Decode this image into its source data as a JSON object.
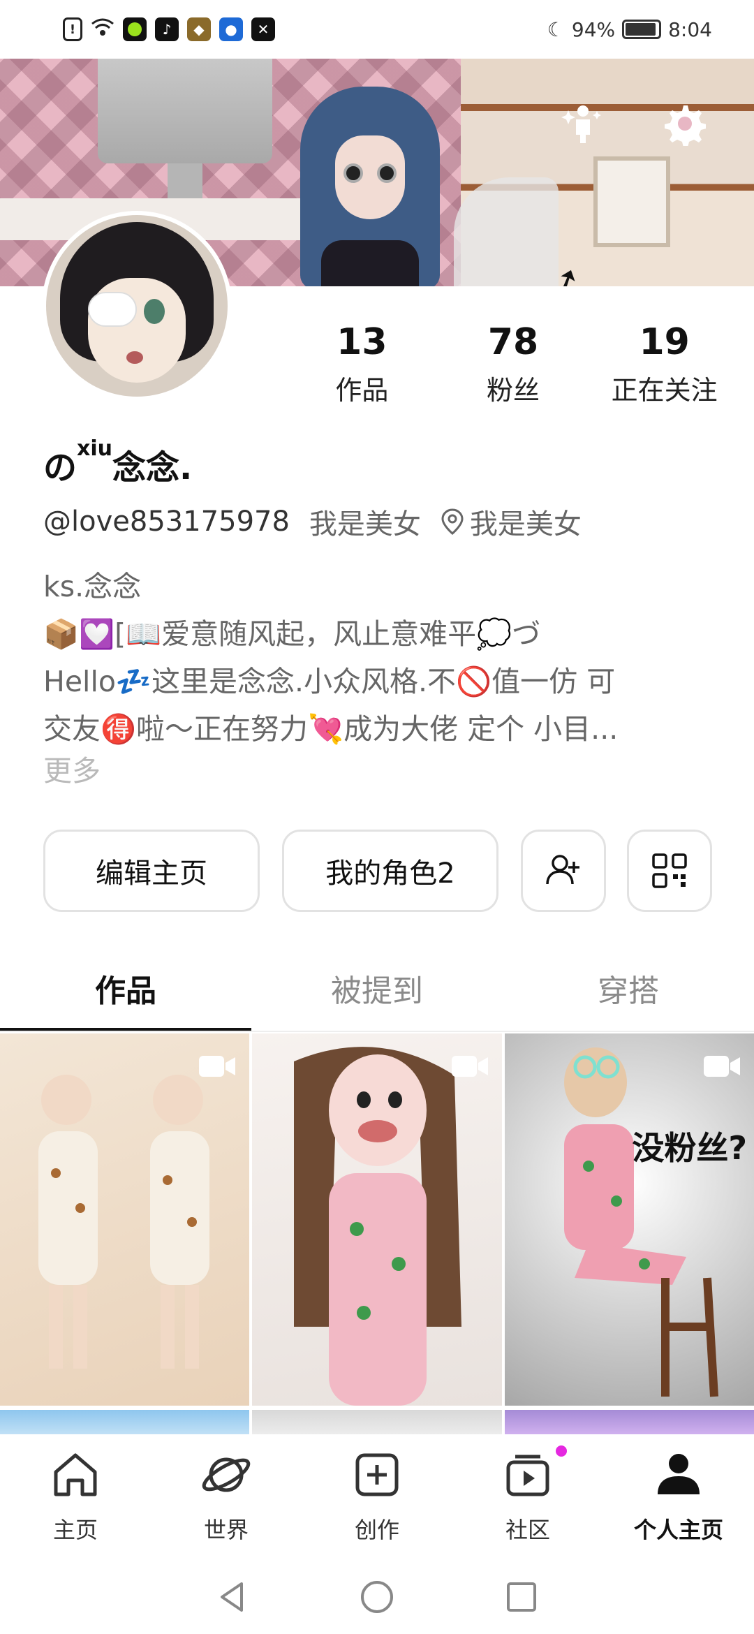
{
  "status_bar": {
    "battery_text": "94%",
    "battery_level": 0.94,
    "time": "8:04",
    "icons": [
      "sim-alert-icon",
      "wifi-icon",
      "green-app-icon",
      "tiktok-icon",
      "transformers-icon",
      "lightbulb-icon",
      "capcut-icon",
      "moon-icon",
      "battery-icon"
    ]
  },
  "profile": {
    "name_prefix": "の",
    "name_sup": "xiu",
    "name_suffix": "念念.",
    "handle": "@love853175978",
    "tag": "我是美女",
    "location": "我是美女",
    "stats": [
      {
        "value": "13",
        "label": "作品"
      },
      {
        "value": "78",
        "label": "粉丝"
      },
      {
        "value": "19",
        "label": "正在关注"
      }
    ],
    "bio": {
      "line1": "ks.念念",
      "line2": "📦💟[📖爱意随风起，风止意难平💭づ",
      "line3": "Hello💤这里是念念.小众风格.不🚫值一仿 可",
      "line4": "交友🉐啦～正在努力💘成为大佬 定个 小目..."
    },
    "more": "更多"
  },
  "buttons": {
    "edit": "编辑主页",
    "role": "我的角色2"
  },
  "tabs": [
    "作品",
    "被提到",
    "穿搭"
  ],
  "grid": {
    "overlay_text": "没粉丝?"
  },
  "nav": [
    {
      "label": "主页"
    },
    {
      "label": "世界"
    },
    {
      "label": "创作"
    },
    {
      "label": "社区"
    },
    {
      "label": "个人主页"
    }
  ],
  "colors": {
    "accent_dot": "#e528e0",
    "text_primary": "#111111",
    "text_secondary": "#666666",
    "banner_pink": "#e8b7c4"
  }
}
